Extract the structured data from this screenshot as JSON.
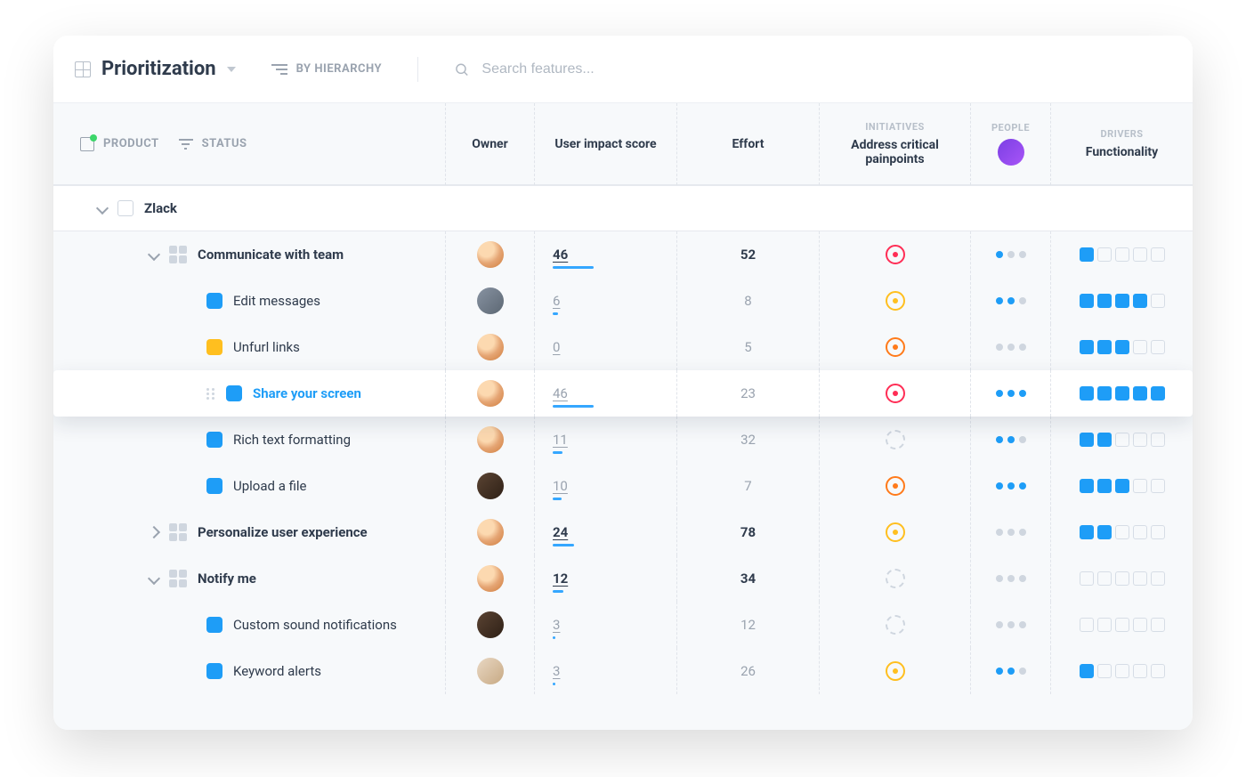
{
  "topbar": {
    "view_title": "Prioritization",
    "hierarchy_label": "BY HIERARCHY",
    "search_placeholder": "Search features..."
  },
  "header": {
    "product_label": "PRODUCT",
    "status_label": "STATUS",
    "columns": {
      "owner": "Owner",
      "score": "User impact score",
      "effort": "Effort",
      "initiatives_tag": "INITIATIVES",
      "initiatives": "Address critical painpoints",
      "people_tag": "PEOPLE",
      "drivers_tag": "DRIVERS",
      "drivers": "Functionality"
    }
  },
  "product": {
    "name": "Zlack"
  },
  "groups": [
    {
      "name": "Communicate with team",
      "expanded": true,
      "owner": "a",
      "score": 46,
      "score_pct": 46,
      "score_strong": true,
      "effort": 52,
      "effort_strong": true,
      "initiative": "red",
      "people": 1,
      "drivers": 1,
      "items": [
        {
          "name": "Edit messages",
          "tag": "blue",
          "owner": "b",
          "score": 6,
          "score_pct": 6,
          "effort": 8,
          "initiative": "yellow",
          "people": 2,
          "drivers": 4
        },
        {
          "name": "Unfurl links",
          "tag": "yellow",
          "owner": "a",
          "score": 0,
          "score_pct": 0,
          "effort": 5,
          "initiative": "orange",
          "people": 0,
          "drivers": 3
        },
        {
          "name": "Share your screen",
          "tag": "blue",
          "owner": "a",
          "score": 46,
          "score_pct": 46,
          "effort": 23,
          "initiative": "red",
          "people": 3,
          "drivers": 5,
          "highlight": true
        },
        {
          "name": "Rich text formatting",
          "tag": "blue",
          "owner": "a",
          "score": 11,
          "score_pct": 11,
          "effort": 32,
          "initiative": "dashed",
          "people": 2,
          "drivers": 2
        },
        {
          "name": "Upload a file",
          "tag": "blue",
          "owner": "c",
          "score": 10,
          "score_pct": 10,
          "effort": 7,
          "initiative": "orange",
          "people": 3,
          "drivers": 3
        }
      ]
    },
    {
      "name": "Personalize user experience",
      "expanded": false,
      "owner": "a",
      "score": 24,
      "score_pct": 24,
      "score_strong": true,
      "effort": 78,
      "effort_strong": true,
      "initiative": "yellow",
      "people": 0,
      "drivers": 2,
      "items": []
    },
    {
      "name": "Notify me",
      "expanded": true,
      "owner": "a",
      "score": 12,
      "score_pct": 12,
      "score_strong": true,
      "effort": 34,
      "effort_strong": true,
      "initiative": "dashed",
      "people": 0,
      "drivers": 0,
      "items": [
        {
          "name": "Custom sound notifications",
          "tag": "blue",
          "owner": "c",
          "score": 3,
          "score_pct": 3,
          "effort": 12,
          "initiative": "dashed",
          "people": 2,
          "people_dim": true,
          "drivers": 0
        },
        {
          "name": "Keyword alerts",
          "tag": "blue",
          "owner": "d",
          "score": 3,
          "score_pct": 3,
          "effort": 26,
          "initiative": "yellow",
          "people": 2,
          "drivers": 1
        }
      ]
    }
  ]
}
